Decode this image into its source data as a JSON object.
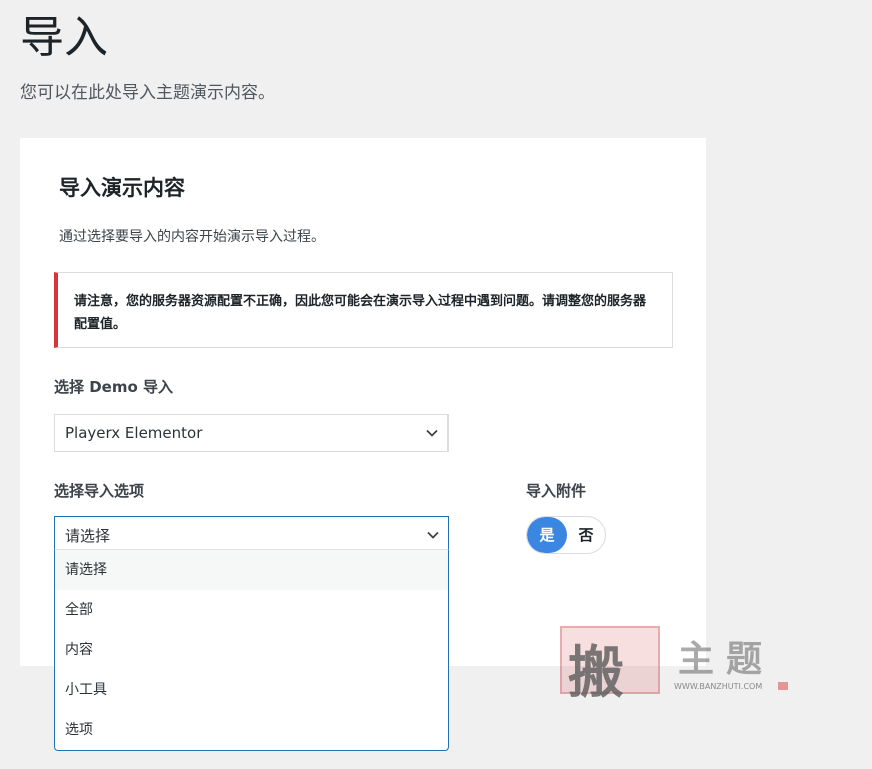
{
  "header": {
    "title": "导入",
    "subtitle": "您可以在此处导入主题演示内容。"
  },
  "card": {
    "title": "导入演示内容",
    "description": "通过选择要导入的内容开始演示导入过程。",
    "notice": "请注意，您的服务器资源配置不正确，因此您可能会在演示导入过程中遇到问题。请调整您的服务器配置值。"
  },
  "demo_select": {
    "label": "选择 Demo 导入",
    "value": "Playerx Elementor"
  },
  "options_select": {
    "label": "选择导入选项",
    "value": "请选择",
    "options": [
      "请选择",
      "全部",
      "内容",
      "小工具",
      "选项"
    ]
  },
  "attachments": {
    "label": "导入附件",
    "yes": "是",
    "no": "否",
    "selected": "是"
  },
  "watermark": {
    "char": "搬",
    "title": "主题",
    "url": "WWW.BANZHUTI.COM"
  },
  "colors": {
    "accent": "#2271b1",
    "toggle_active": "#3a86e0",
    "notice_border": "#d63638"
  }
}
